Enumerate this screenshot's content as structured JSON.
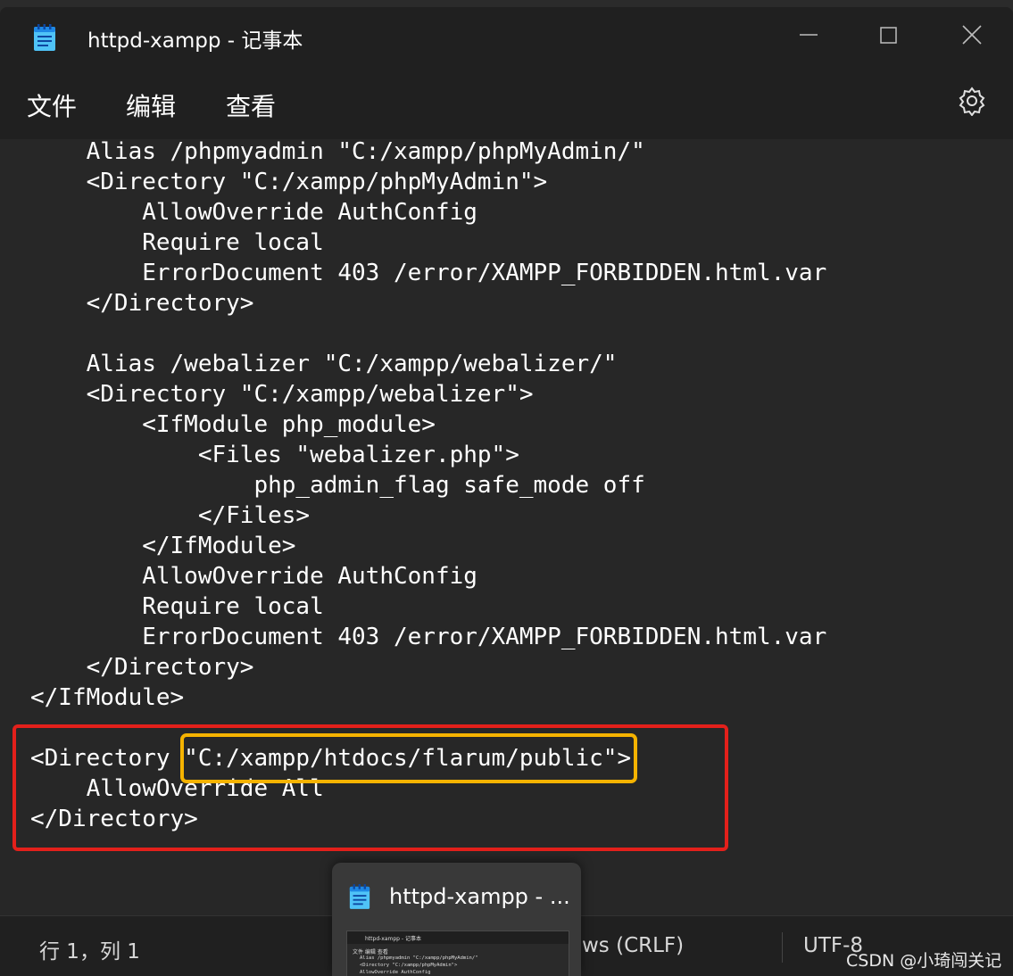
{
  "window": {
    "title": "httpd-xampp - 记事本"
  },
  "menu": {
    "file": "文件",
    "edit": "编辑",
    "view": "查看"
  },
  "editor": {
    "lines": [
      "    Alias /phpmyadmin \"C:/xampp/phpMyAdmin/\"",
      "    <Directory \"C:/xampp/phpMyAdmin\">",
      "        AllowOverride AuthConfig",
      "        Require local",
      "        ErrorDocument 403 /error/XAMPP_FORBIDDEN.html.var",
      "    </Directory>",
      "",
      "    Alias /webalizer \"C:/xampp/webalizer/\"",
      "    <Directory \"C:/xampp/webalizer\">",
      "        <IfModule php_module>",
      "            <Files \"webalizer.php\">",
      "                php_admin_flag safe_mode off",
      "            </Files>",
      "        </IfModule>",
      "        AllowOverride AuthConfig",
      "        Require local",
      "        ErrorDocument 403 /error/XAMPP_FORBIDDEN.html.var",
      "    </Directory>",
      "</IfModule>",
      "",
      "<Directory \"C:/xampp/htdocs/flarum/public\">",
      "    AllowOverride All",
      "</Directory>"
    ]
  },
  "status": {
    "position": "行 1，列 1",
    "line_ending": "ws (CRLF)",
    "encoding": "UTF-8"
  },
  "taskbar_preview": {
    "title": "httpd-xampp - ...",
    "thumb_title": "httpd-xampp - 记事本",
    "thumb_menu": "文件    编辑    查看",
    "thumb_lines": [
      "  Alias /phpmyadmin \"C:/xampp/phpMyAdmin/\"",
      "  <Directory \"C:/xampp/phpMyAdmin\">",
      "      AllowOverride AuthConfig"
    ]
  },
  "watermark": "CSDN @小琦闯关记",
  "colors": {
    "highlight_red": "#e3201b",
    "highlight_yellow": "#f5b300"
  }
}
